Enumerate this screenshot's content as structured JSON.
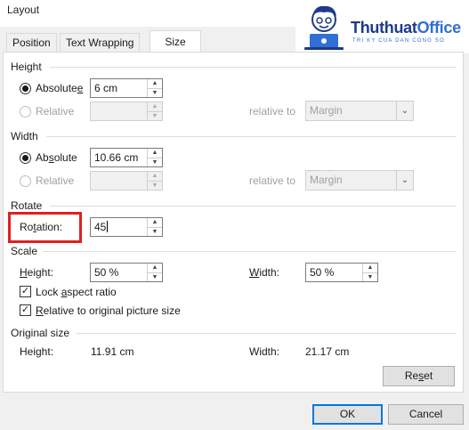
{
  "window": {
    "title": "Layout",
    "help": "?",
    "close": "✕"
  },
  "logo": {
    "brand_a": "Thuthuat",
    "brand_b": "Office",
    "tagline": "TRI KY CUA DAN CONG SO"
  },
  "tabs": [
    {
      "label": "Position"
    },
    {
      "label": "Text Wrapping"
    },
    {
      "label": "Size",
      "active": true
    }
  ],
  "height": {
    "section": "Height",
    "absolute_pre": "Absolute",
    "absolute_u": "e",
    "absolute_value": "6 cm",
    "relative_label": "Relative",
    "relative_to_label": "relative to",
    "relative_to_value": "Margin"
  },
  "width": {
    "section": "Width",
    "absolute_pre": "Ab",
    "absolute_u": "s",
    "absolute_post": "olute",
    "absolute_value": "10.66 cm",
    "relative_label": "Relative",
    "relative_to_label": "relative to",
    "relative_to_value": "Margin"
  },
  "rotate": {
    "section": "Rotate",
    "label_pre": "Ro",
    "label_u": "t",
    "label_post": "ation:",
    "value": "45"
  },
  "scale": {
    "section": "Scale",
    "height_u": "H",
    "height_post": "eight:",
    "height_value": "50 %",
    "width_u": "W",
    "width_post": "idth:",
    "width_value": "50 %",
    "lock_pre": "Lock ",
    "lock_u": "a",
    "lock_post": "spect ratio",
    "lock_checked": true,
    "relative_u": "R",
    "relative_post": "elative to original picture size",
    "relative_checked": true
  },
  "original": {
    "section": "Original size",
    "height_label": "Height:",
    "height_value": "11.91 cm",
    "width_label": "Width:",
    "width_value": "21.17 cm"
  },
  "buttons": {
    "reset_pre": "Re",
    "reset_u": "s",
    "reset_post": "et",
    "ok": "OK",
    "cancel": "Cancel"
  },
  "colors": {
    "highlight": "#e02020",
    "accent": "#0078d7"
  }
}
